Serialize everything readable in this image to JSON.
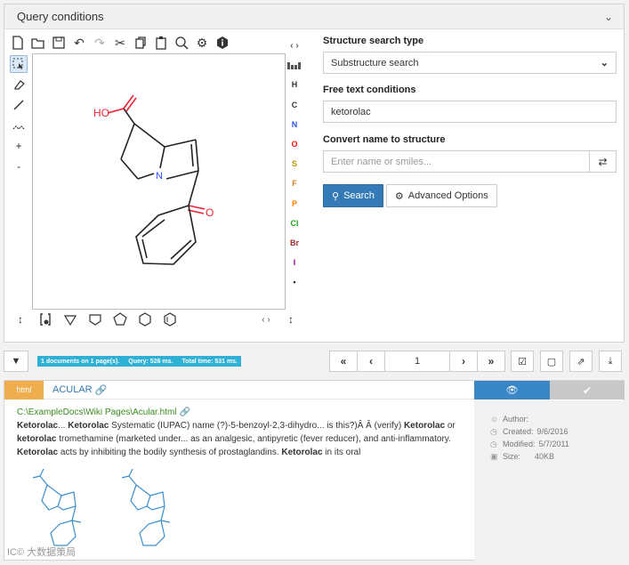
{
  "panel": {
    "title": "Query conditions"
  },
  "editor": {
    "toolbar": [
      "new-icon",
      "open-icon",
      "save-icon",
      "undo-icon",
      "redo-icon",
      "cut-icon",
      "copy-icon",
      "paste-icon",
      "zoom-icon",
      "settings-icon",
      "info-icon"
    ],
    "left_tools": [
      "select-tool",
      "erase-tool",
      "bond-tool",
      "chain-tool",
      "charge-plus",
      "charge-minus"
    ],
    "left_labels": {
      "plus": "+",
      "minus": "-"
    },
    "atoms": [
      {
        "label": "H",
        "color": "#333333"
      },
      {
        "label": "C",
        "color": "#333333"
      },
      {
        "label": "N",
        "color": "#3050f8"
      },
      {
        "label": "O",
        "color": "#ff0d0d"
      },
      {
        "label": "S",
        "color": "#b8a000"
      },
      {
        "label": "F",
        "color": "#d08020"
      },
      {
        "label": "P",
        "color": "#ff8000"
      },
      {
        "label": "Cl",
        "color": "#1fa01f"
      },
      {
        "label": "Br",
        "color": "#a62929"
      },
      {
        "label": "I",
        "color": "#940094"
      },
      {
        "label": "•",
        "color": "#333333"
      }
    ],
    "atom_header": "‹ ›",
    "bottom_arrows": "‹ ›",
    "molecule_labels": {
      "oh": "HO",
      "n": "N",
      "o": "O",
      "o2": "O"
    }
  },
  "form": {
    "structure_type_label": "Structure search type",
    "structure_type_value": "Substructure search",
    "free_text_label": "Free text conditions",
    "free_text_value": "ketorolac",
    "convert_label": "Convert name to structure",
    "convert_placeholder": "Enter name or smiles...",
    "search_label": "Search",
    "advanced_label": "Advanced Options"
  },
  "results_bar": {
    "docs": "1 documents on 1 page(s).",
    "query": "Query: 526 ms.",
    "total": "Total time: 531 ms.",
    "page": "1",
    "first": "«",
    "prev": "‹",
    "next": "›",
    "last": "»"
  },
  "result": {
    "type": "html",
    "title": "ACULAR",
    "path": "C:\\ExampleDocs\\Wiki Pages\\Acular.html",
    "snippet": [
      {
        "t": "Ketorolac",
        "b": true
      },
      {
        "t": "... ",
        "b": false
      },
      {
        "t": "Ketorolac",
        "b": true
      },
      {
        "t": " Systematic (IUPAC) name (?)-5-benzoyl-2,3-dihydro... is this?)Â Â (verify) ",
        "b": false
      },
      {
        "t": "Ketorolac",
        "b": true
      },
      {
        "t": " or ",
        "b": false
      },
      {
        "t": "ketorolac",
        "b": true
      },
      {
        "t": " tromethamine (marketed under... as an analgesic, antipyretic (fever reducer), and anti-inflammatory. ",
        "b": false
      },
      {
        "t": "Ketorolac",
        "b": true
      },
      {
        "t": " acts by inhibiting the bodily synthesis of prostaglandins. ",
        "b": false
      },
      {
        "t": "Ketorolac",
        "b": true
      },
      {
        "t": " in its oral",
        "b": false
      }
    ],
    "meta": {
      "author_label": "Author:",
      "author_value": "",
      "created_label": "Created:",
      "created_value": "9/6/2016",
      "modified_label": "Modified:",
      "modified_value": "5/7/2011",
      "size_label": "Size:",
      "size_value": "40KB"
    }
  },
  "watermark": "IC© 大数据策局"
}
